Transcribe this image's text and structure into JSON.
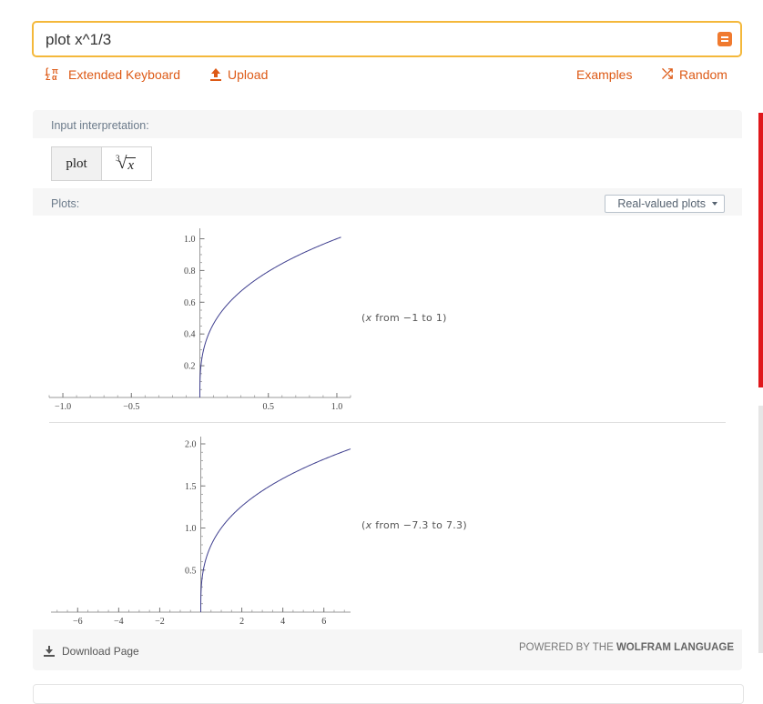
{
  "search": {
    "query": "plot x^1/3"
  },
  "toolbar": {
    "extended_keyboard": "Extended Keyboard",
    "upload": "Upload",
    "examples": "Examples",
    "random": "Random"
  },
  "input_interpretation": {
    "header": "Input interpretation:",
    "word": "plot",
    "math_index": "3",
    "math_variable": "x"
  },
  "plots": {
    "header": "Plots:",
    "dropdown": "Real-valued plots",
    "plot1": {
      "range_prefix": "(",
      "range_var": "x",
      "range_text": " from −1 to 1)",
      "x_ticks": [
        "−1.0",
        "−0.5",
        "0.5",
        "1.0"
      ],
      "y_ticks": [
        "0.2",
        "0.4",
        "0.6",
        "0.8",
        "1.0"
      ]
    },
    "plot2": {
      "range_prefix": "(",
      "range_var": "x",
      "range_text": " from −7.3 to 7.3)",
      "x_ticks": [
        "−6",
        "−4",
        "−2",
        "2",
        "4",
        "6"
      ],
      "y_ticks": [
        "0.5",
        "1.0",
        "1.5",
        "2.0"
      ]
    }
  },
  "footer": {
    "download": "Download Page",
    "powered_prefix": "POWERED BY THE ",
    "powered_brand": "WOLFRAM LANGUAGE"
  },
  "colors": {
    "accent": "#dd5a16",
    "search_border": "#f4b83b",
    "curve": "#3f3f8f"
  },
  "chart_data": [
    {
      "type": "line",
      "function": "x^(1/3)",
      "x": [
        0,
        0.001,
        0.01,
        0.05,
        0.1,
        0.2,
        0.3,
        0.4,
        0.5,
        0.6,
        0.7,
        0.8,
        0.9,
        1.0,
        1.03
      ],
      "y": [
        0,
        0.1,
        0.215,
        0.368,
        0.464,
        0.585,
        0.669,
        0.737,
        0.794,
        0.843,
        0.888,
        0.928,
        0.965,
        1.0,
        1.01
      ],
      "xlim": [
        -1.1,
        1.1
      ],
      "ylim": [
        0,
        1.02
      ],
      "x_ticks": [
        -1.0,
        -0.5,
        0.5,
        1.0
      ],
      "y_ticks": [
        0.2,
        0.4,
        0.6,
        0.8,
        1.0
      ]
    },
    {
      "type": "line",
      "function": "x^(1/3)",
      "x": [
        0,
        0.01,
        0.1,
        0.5,
        1,
        2,
        3,
        4,
        5,
        6,
        7,
        7.3
      ],
      "y": [
        0,
        0.215,
        0.464,
        0.794,
        1.0,
        1.26,
        1.442,
        1.587,
        1.71,
        1.817,
        1.913,
        1.94
      ],
      "xlim": [
        -7.3,
        7.3
      ],
      "ylim": [
        0,
        2.0
      ],
      "x_ticks": [
        -6,
        -4,
        -2,
        2,
        4,
        6
      ],
      "y_ticks": [
        0.5,
        1.0,
        1.5,
        2.0
      ]
    }
  ]
}
